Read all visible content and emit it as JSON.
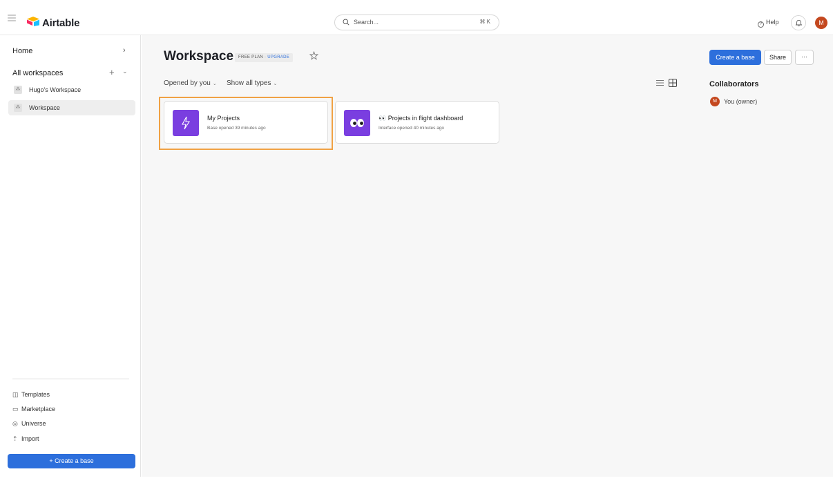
{
  "topbar": {
    "app_name": "Airtable",
    "search_placeholder": "Search...",
    "search_shortcut": "⌘ K",
    "help_label": "Help",
    "avatar_initial": "M"
  },
  "sidebar": {
    "home_label": "Home",
    "all_workspaces_label": "All workspaces",
    "workspaces": [
      {
        "label": "Hugo's Workspace",
        "active": false
      },
      {
        "label": "Workspace",
        "active": true
      }
    ],
    "links": [
      {
        "label": "Templates",
        "icon": "book-icon"
      },
      {
        "label": "Marketplace",
        "icon": "store-icon"
      },
      {
        "label": "Universe",
        "icon": "planet-icon"
      },
      {
        "label": "Import",
        "icon": "upload-icon"
      }
    ],
    "create_base_label": "+ Create a base"
  },
  "main": {
    "title": "Workspace",
    "plan_label": "FREE PLAN",
    "plan_sep": "·",
    "upgrade_label": "UPGRADE",
    "filter_opened": "Opened by you",
    "filter_types": "Show all types",
    "bases": [
      {
        "name": "My Projects",
        "subtitle": "Base opened 39 minutes ago",
        "icon": "lightning-icon",
        "color": "#7a3ee0"
      },
      {
        "name": "👀 Projects in flight dashboard",
        "subtitle": "Interface opened 40 minutes ago",
        "icon": "eyes-icon",
        "color": "#7a3ee0"
      }
    ]
  },
  "right_panel": {
    "create_base_label": "Create a base",
    "share_label": "Share",
    "more_label": "···",
    "collaborators_title": "Collaborators",
    "collaborator_initial": "M",
    "collaborator_name": "You (owner)"
  },
  "colors": {
    "accent": "#2d6fdc",
    "tile": "#7a3ee0",
    "avatar": "#c4481f",
    "highlight": "#f0a144"
  }
}
